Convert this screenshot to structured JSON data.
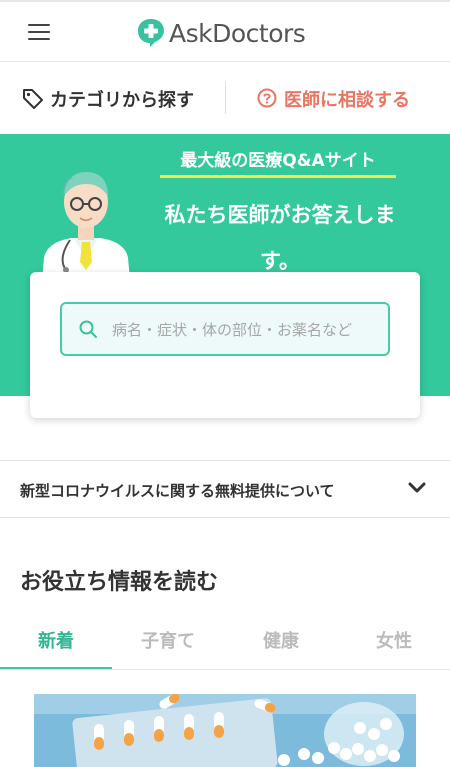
{
  "header": {
    "logo_text": "AskDoctors"
  },
  "subnav": {
    "category_label": "カテゴリから探す",
    "consult_label": "医師に相談する"
  },
  "hero": {
    "subtitle": "最大級の医療Q&Aサイト",
    "title_line1": "私たち医師がお答えしま",
    "title_line2": "す。"
  },
  "search": {
    "placeholder": "病名・症状・体の部位・お薬名など"
  },
  "notice": {
    "text": "新型コロナウイルスに関する無料提供について"
  },
  "section": {
    "title": "お役立ち情報を読む"
  },
  "tabs": [
    {
      "label": "新着",
      "active": true
    },
    {
      "label": "子育て",
      "active": false
    },
    {
      "label": "健康",
      "active": false
    },
    {
      "label": "女性",
      "active": false
    }
  ],
  "colors": {
    "brand_green": "#33c99d",
    "accent_orange": "#e87661",
    "underline_yellow": "#f1ea47"
  }
}
